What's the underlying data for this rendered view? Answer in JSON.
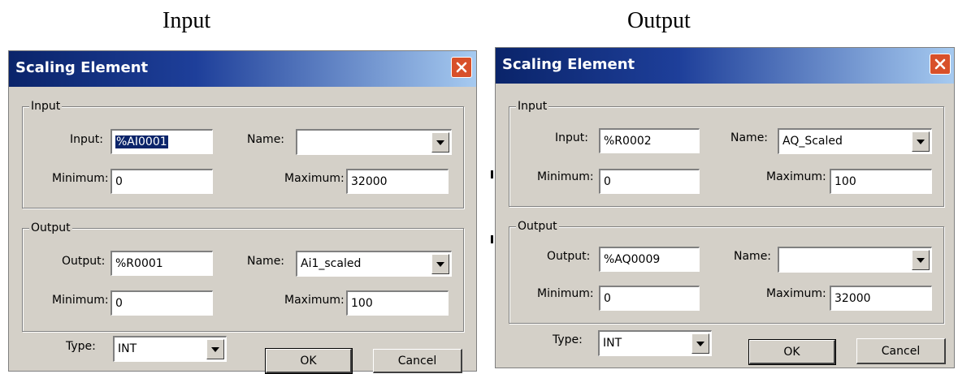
{
  "captions": {
    "left": "Input",
    "right": "Output"
  },
  "dialogs": [
    {
      "title": "Scaling Element",
      "input_group": {
        "title": "Input",
        "input_label": "Input:",
        "input_value": "%AI0001",
        "name_label": "Name:",
        "name_value": "",
        "min_label": "Minimum:",
        "min_value": "0",
        "max_label": "Maximum:",
        "max_value": "32000"
      },
      "output_group": {
        "title": "Output",
        "output_label": "Output:",
        "output_value": "%R0001",
        "name_label": "Name:",
        "name_value": "Ai1_scaled",
        "min_label": "Minimum:",
        "min_value": "0",
        "max_label": "Maximum:",
        "max_value": "100"
      },
      "type_label": "Type:",
      "type_value": "INT",
      "ok_label": "OK",
      "cancel_label": "Cancel"
    },
    {
      "title": "Scaling Element",
      "input_group": {
        "title": "Input",
        "input_label": "Input:",
        "input_value": "%R0002",
        "name_label": "Name:",
        "name_value": "AQ_Scaled",
        "min_label": "Minimum:",
        "min_value": "0",
        "max_label": "Maximum:",
        "max_value": "100"
      },
      "output_group": {
        "title": "Output",
        "output_label": "Output:",
        "output_value": "%AQ0009",
        "name_label": "Name:",
        "name_value": "",
        "min_label": "Minimum:",
        "min_value": "0",
        "max_label": "Maximum:",
        "max_value": "32000"
      },
      "type_label": "Type:",
      "type_value": "INT",
      "ok_label": "OK",
      "cancel_label": "Cancel"
    }
  ],
  "colors": {
    "dialog_bg": "#d4d0c8",
    "title_gradient_start": "#0a246a",
    "title_gradient_end": "#a6caf0",
    "close_button": "#d8502a",
    "selection": "#0a246a"
  },
  "icons": {
    "close": "close-icon",
    "dropdown": "chevron-down-icon"
  }
}
